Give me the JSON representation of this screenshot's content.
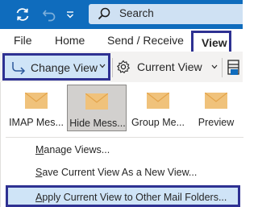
{
  "titlebar": {
    "icons": [
      "sync-icon",
      "undo-icon",
      "quick-access-dropdown-icon",
      "search-icon"
    ],
    "search_placeholder": "Search",
    "colors": {
      "bar": "#0f6cbd",
      "search_bg": "#cfe1f3"
    }
  },
  "ribbon_tabs": [
    {
      "label": "File"
    },
    {
      "label": "Home"
    },
    {
      "label": "Send / Receive"
    },
    {
      "label": "View",
      "active": true
    }
  ],
  "commands": {
    "change_view": {
      "label": "Change View",
      "icon": "change-view-arrow-icon"
    },
    "current_view": {
      "label": "Current View",
      "icon": "settings-gear-icon"
    },
    "layout_icon": "layout-pane-icon"
  },
  "view_gallery": [
    {
      "label": "IMAP Mes...",
      "icon": "envelope-icon"
    },
    {
      "label": "Hide Mess...",
      "icon": "envelope-icon",
      "selected": true
    },
    {
      "label": "Group Me...",
      "icon": "envelope-icon"
    },
    {
      "label": "Preview",
      "icon": "envelope-icon"
    }
  ],
  "menu_items": [
    {
      "label_pre": "",
      "label_ul": "M",
      "label_post": "anage Views..."
    },
    {
      "label_pre": "",
      "label_ul": "S",
      "label_post": "ave Current View As a New View..."
    },
    {
      "label_pre": "",
      "label_ul": "A",
      "label_post": "pply Current View to Other Mail Folders...",
      "highlighted": true
    }
  ],
  "colors": {
    "highlight_border": "#2e3192",
    "highlight_fill": "#cfe4f7",
    "accent": "#0f6cbd",
    "envelope": "#f0c27b"
  }
}
